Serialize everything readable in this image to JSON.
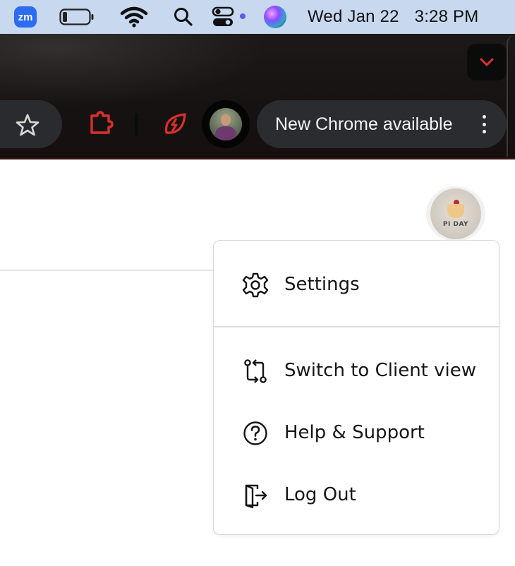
{
  "menubar": {
    "zoom_label": "zm",
    "date": "Wed Jan 22",
    "time": "3:28 PM",
    "icons": [
      "zoom-icon",
      "battery-icon",
      "wifi-icon",
      "spotlight-search-icon",
      "control-center-icon",
      "siri-icon"
    ]
  },
  "chrome": {
    "update_label": "New Chrome available",
    "icons": [
      "tab-search-chevron-icon",
      "bookmark-star-icon",
      "extension-puzzle-icon",
      "extension-leaf-icon",
      "more-vertical-icon"
    ],
    "accent_red": "#d9302c"
  },
  "profile": {
    "badge_text": "PI DAY"
  },
  "menu": {
    "items": [
      {
        "label": "Settings",
        "icon": "gear-icon"
      },
      {
        "label": "Switch to Client view",
        "icon": "switch-view-icon"
      },
      {
        "label": "Help & Support",
        "icon": "help-circle-icon"
      },
      {
        "label": "Log Out",
        "icon": "logout-icon"
      }
    ]
  }
}
